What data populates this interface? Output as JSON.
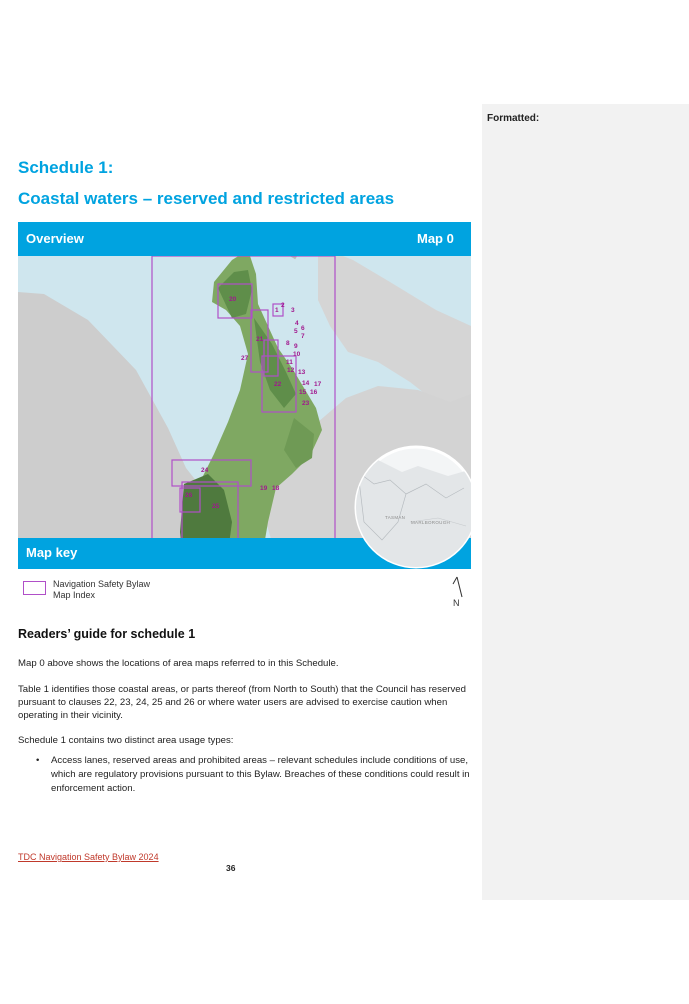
{
  "comments_panel": {
    "heading": "Formatted:"
  },
  "title_line1": "Schedule 1:",
  "title_line2": "Coastal waters – reserved and restricted areas",
  "map": {
    "header_left": "Overview",
    "header_right": "Map 0",
    "footer_label": "Map key",
    "area_numbers": [
      "20",
      "1",
      "2",
      "3",
      "4",
      "5",
      "6",
      "7",
      "8",
      "9",
      "10",
      "21",
      "27",
      "11",
      "12",
      "13",
      "22",
      "14",
      "17",
      "15",
      "16",
      "23",
      "24",
      "19",
      "18",
      "26",
      "25"
    ],
    "inset_labels": [
      "TASMAN",
      "MARLBOROUGH"
    ],
    "colors": {
      "banner": "#00a3e0",
      "index_boxes": "#b04fc8",
      "sea": "#cfe6ee",
      "district": "#7fa862"
    }
  },
  "legend": {
    "line1": "Navigation Safety Bylaw",
    "line2": "Map Index"
  },
  "north_label": "N",
  "readers_guide": {
    "heading": "Readers’ guide for schedule 1",
    "p1": "Map 0 above shows the locations of area maps referred to in this Schedule.",
    "p2": "Table 1 identifies those coastal areas, or parts thereof (from North to South) that the Council has reserved pursuant to clauses 22, 23, 24, 25 and 26 or where water users are advised to exercise caution when operating in their vicinity.",
    "p3": "Schedule 1 contains two distinct area usage types:",
    "bullet1": "Access lanes, reserved areas and prohibited areas – relevant schedules include conditions of use, which are regulatory provisions pursuant to this Bylaw. Breaches of these conditions could result in enforcement action."
  },
  "footer": {
    "link": "TDC Navigation Safety Bylaw 2024",
    "page": "36"
  }
}
